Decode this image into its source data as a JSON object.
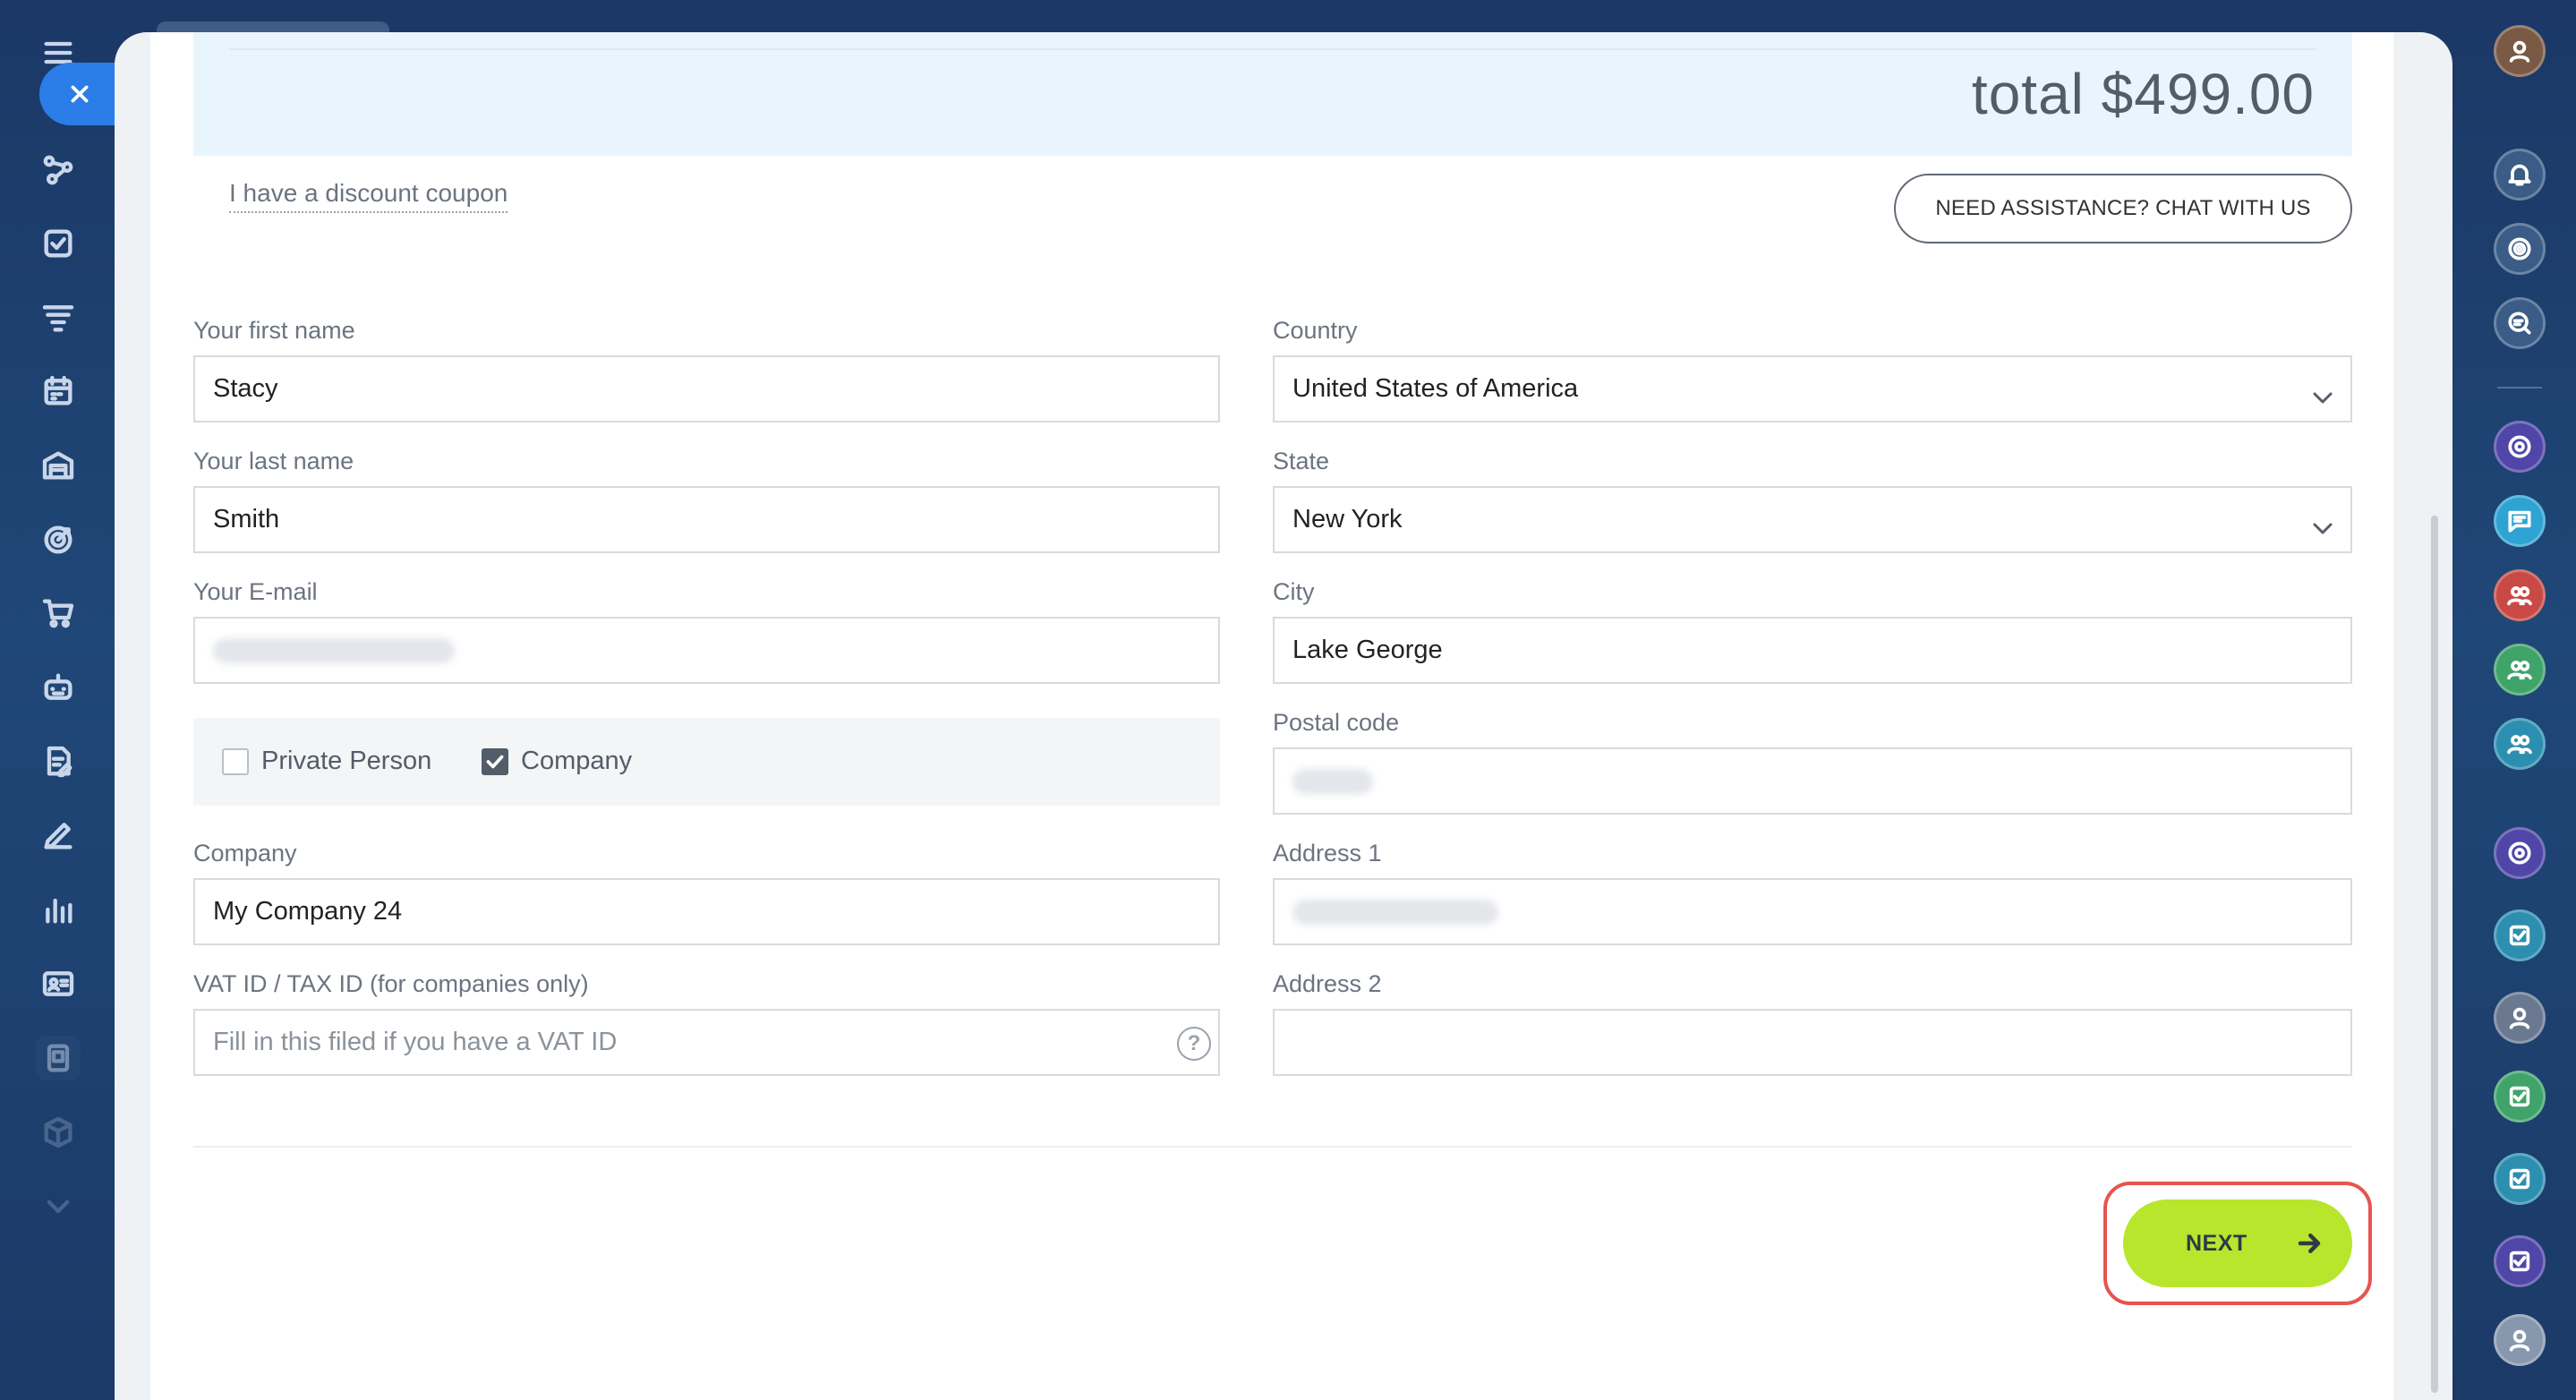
{
  "order": {
    "total_text": "total $499.00",
    "coupon_link": "I have a discount coupon",
    "assist_button": "NEED ASSISTANCE? CHAT WITH US"
  },
  "form": {
    "first_name": {
      "label": "Your first name",
      "value": "Stacy"
    },
    "last_name": {
      "label": "Your last name",
      "value": "Smith"
    },
    "email": {
      "label": "Your E-mail",
      "value": ""
    },
    "person_type": {
      "options": [
        {
          "label": "Private Person",
          "checked": false
        },
        {
          "label": "Company",
          "checked": true
        }
      ]
    },
    "company": {
      "label": "Company",
      "value": "My Company 24"
    },
    "vat": {
      "label": "VAT ID / TAX ID (for companies only)",
      "placeholder": "Fill in this filed if you have a VAT ID",
      "help": "?"
    },
    "country": {
      "label": "Country",
      "value": "United States of America"
    },
    "state": {
      "label": "State",
      "value": "New York"
    },
    "city": {
      "label": "City",
      "value": "Lake George"
    },
    "postal_code": {
      "label": "Postal code",
      "value": ""
    },
    "address1": {
      "label": "Address 1",
      "value": ""
    },
    "address2": {
      "label": "Address 2",
      "value": ""
    }
  },
  "actions": {
    "next_label": "NEXT"
  },
  "left_rail": {
    "icons": [
      "menu-icon",
      "close-icon",
      "sites-icon",
      "tasks-icon",
      "funnel-icon",
      "calendar-icon",
      "warehouse-icon",
      "target-icon",
      "cart-icon",
      "robot-icon",
      "document-sign-icon",
      "pen-icon",
      "analytics-icon",
      "contact-card-icon",
      "marketplace-icon",
      "box-icon",
      "more-chevron-icon"
    ]
  },
  "right_rail": {
    "icons": [
      "user-avatar",
      "bell-icon",
      "crm-icon",
      "search-chat-icon",
      "open-channel-icon",
      "chat-icon",
      "group-icon",
      "group-icon",
      "group-icon",
      "open-channel-icon",
      "task-icon",
      "user-avatar",
      "task-icon",
      "task-icon",
      "task-icon",
      "user-avatar"
    ]
  },
  "colors": {
    "accent": "#2b7ee8",
    "next_button": "#b7e62c",
    "highlight": "#e6544f",
    "total_bg": "#e9f5fc",
    "sidebar_bg": "#1b3866"
  }
}
